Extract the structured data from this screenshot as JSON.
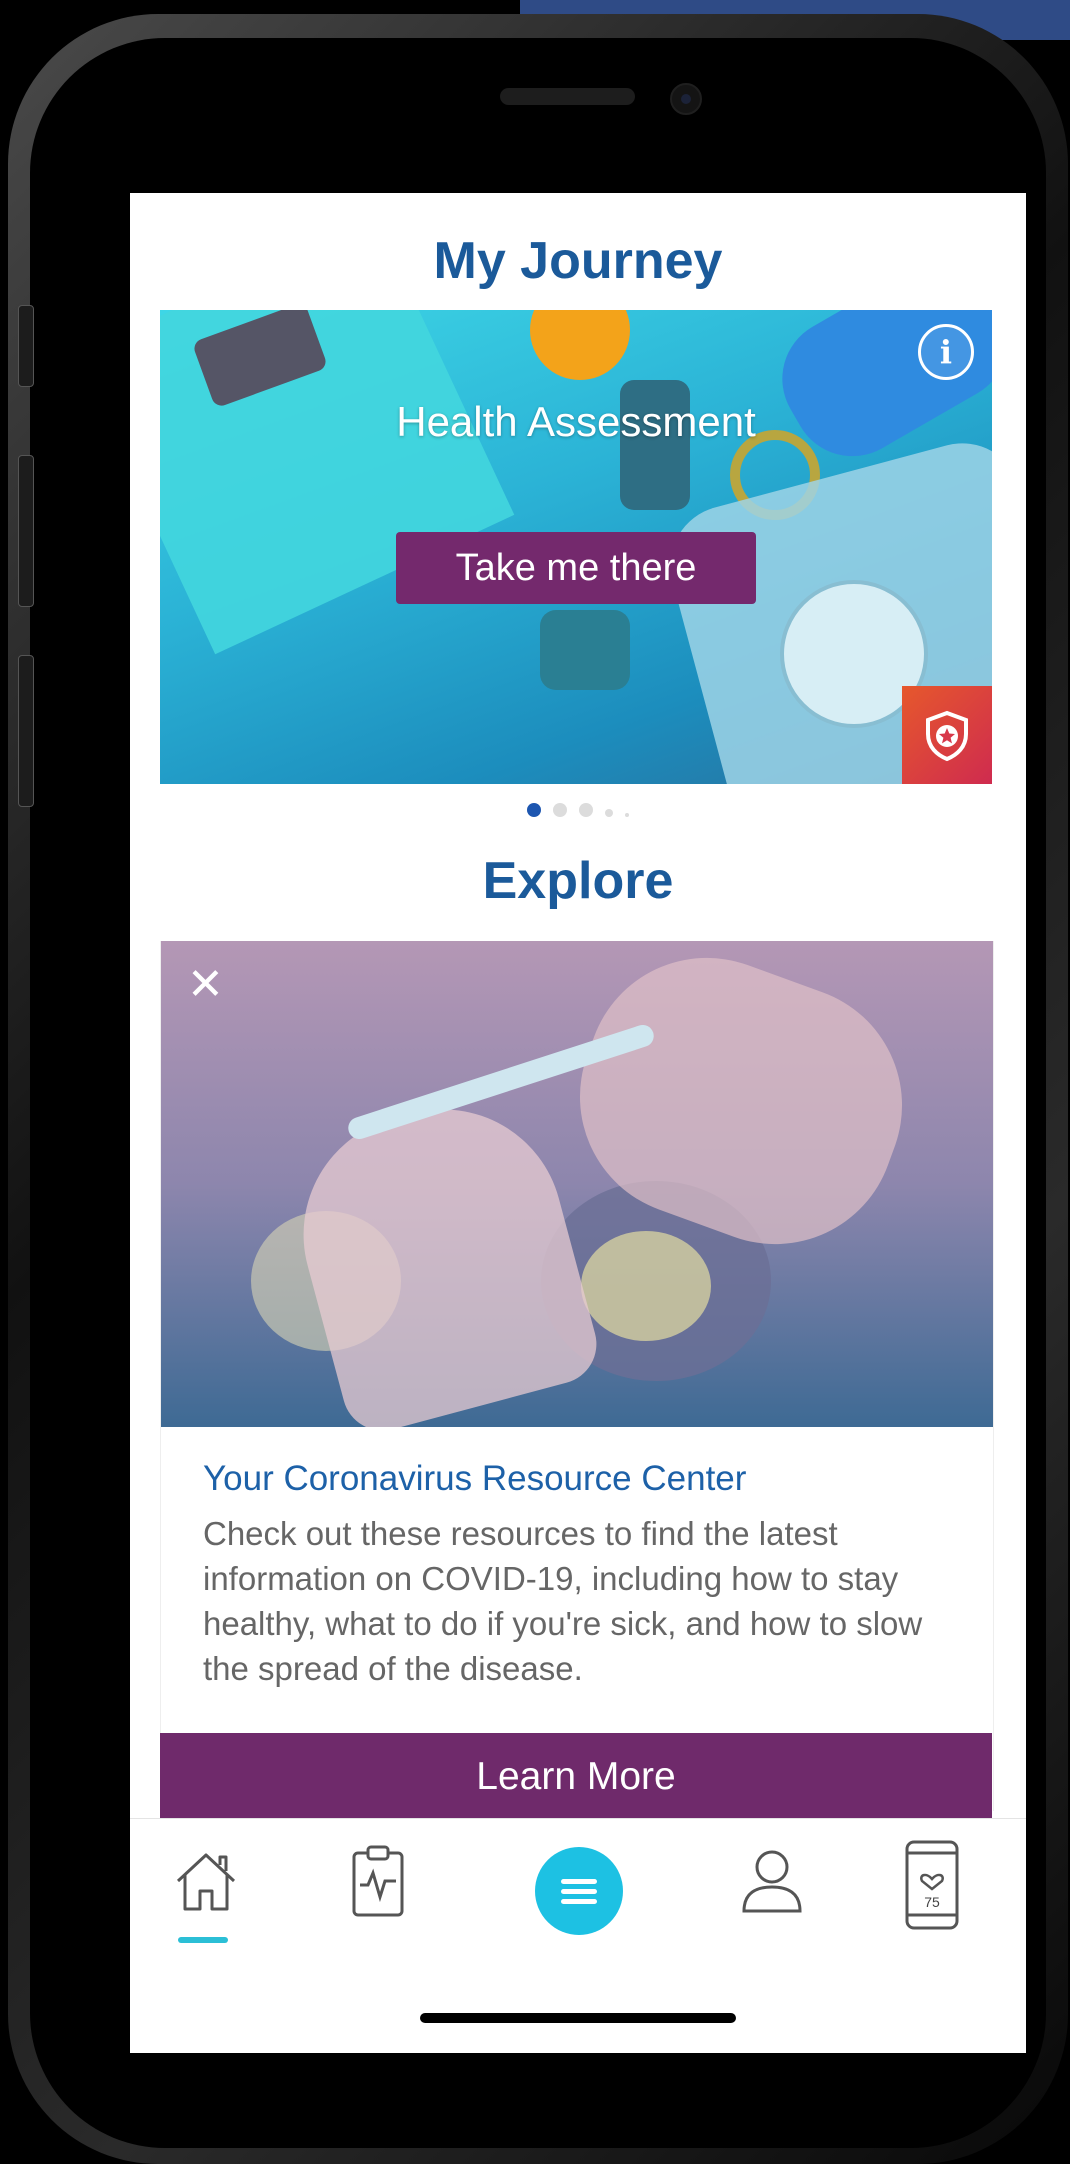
{
  "journey": {
    "title": "My Journey",
    "card_title": "Health Assessment",
    "button_label": "Take me there",
    "info_icon": "i",
    "carousel_index": 1,
    "carousel_count": 5
  },
  "explore": {
    "title": "Explore",
    "card": {
      "title": "Your Coronavirus Resource Center",
      "description": "Check out these resources to find the latest information on COVID-19, including how to stay healthy, what to do if you're sick, and how to slow the spread of the disease.",
      "button_label": "Learn More",
      "close_icon": "✕"
    }
  },
  "nav": {
    "items": [
      {
        "icon": "home-icon",
        "active": true
      },
      {
        "icon": "health-clipboard-icon",
        "active": false
      },
      {
        "icon": "menu-icon",
        "active": false
      },
      {
        "icon": "profile-icon",
        "active": false
      },
      {
        "icon": "device-steps-icon",
        "label": "75",
        "active": false
      }
    ]
  },
  "colors": {
    "title_blue": "#1b5a9a",
    "button_purple": "#74296d",
    "accent_cyan": "#1dc1e3",
    "link_blue": "#1d61a8"
  }
}
